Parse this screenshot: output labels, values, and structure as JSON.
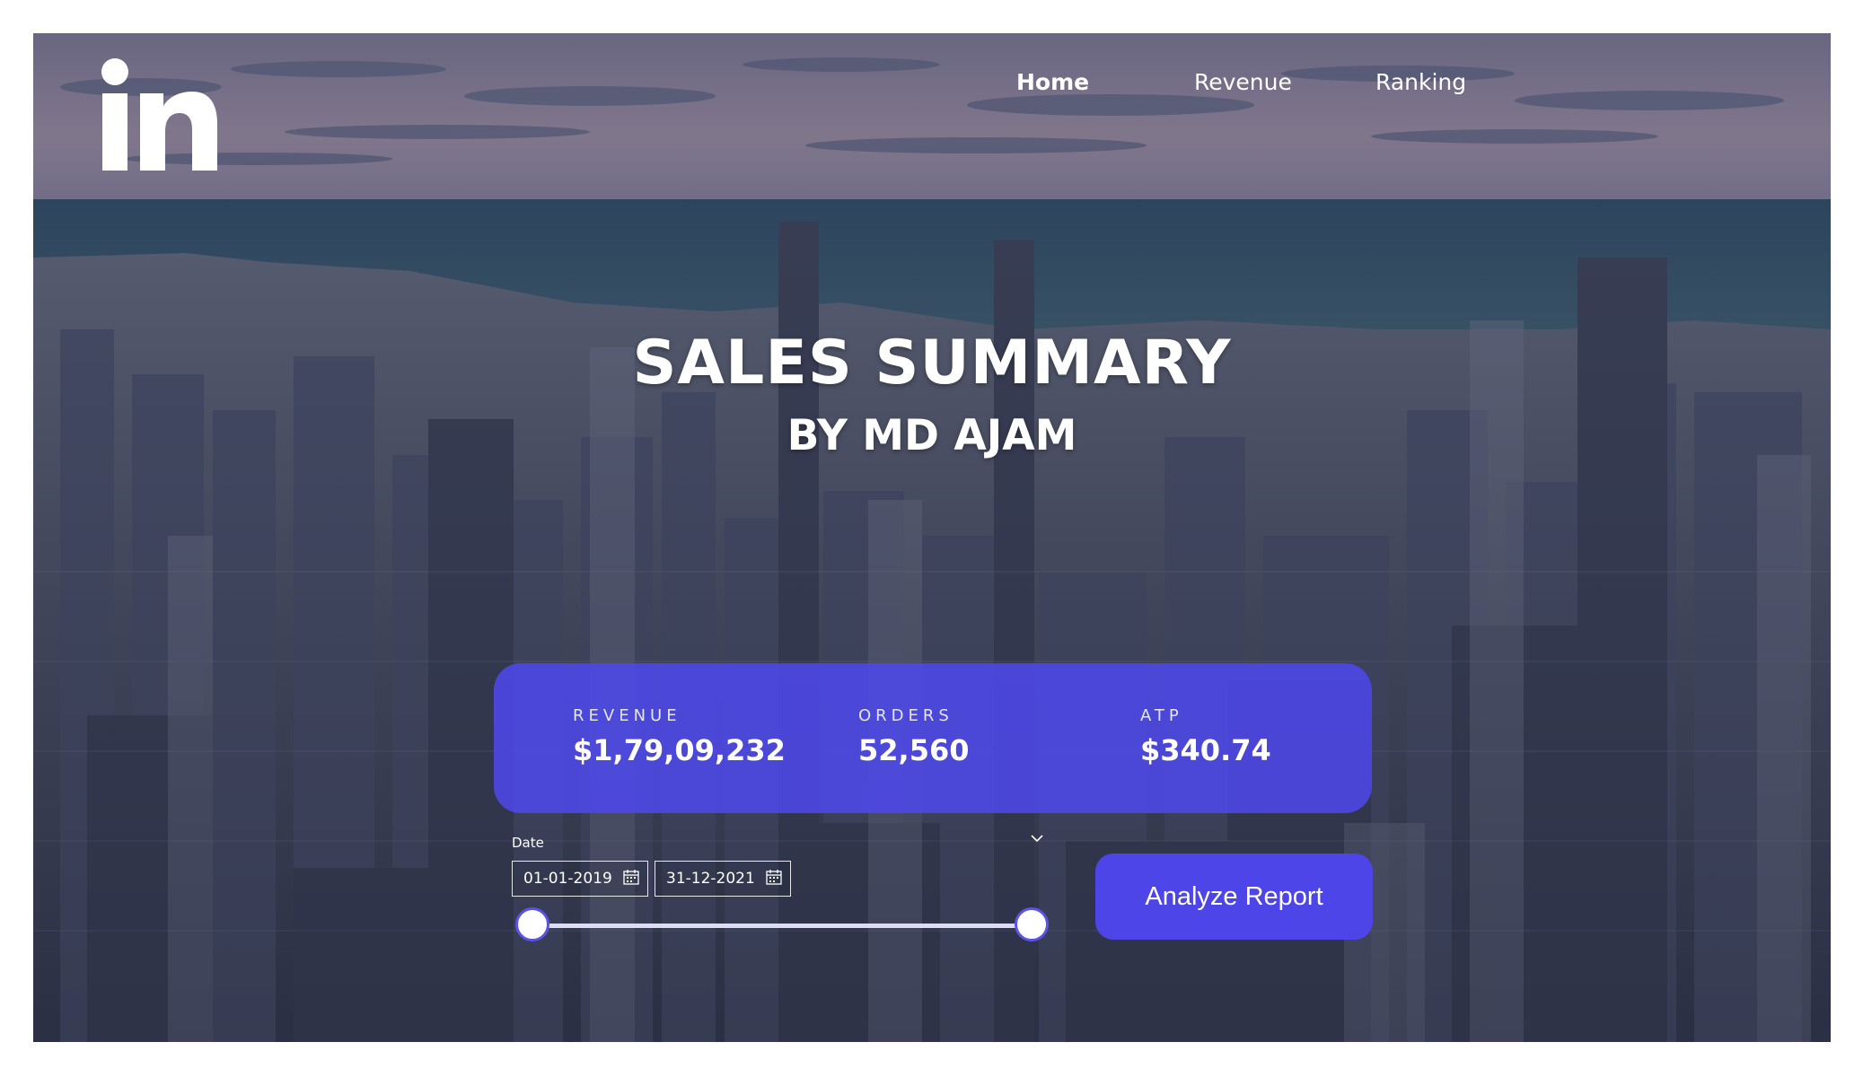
{
  "logo": {
    "icon": "linkedin-in-logo",
    "text": "in"
  },
  "nav": {
    "items": [
      {
        "label": "Home",
        "active": true
      },
      {
        "label": "Revenue",
        "active": false
      },
      {
        "label": "Ranking",
        "active": false
      }
    ]
  },
  "hero": {
    "title": "SALES SUMMARY",
    "subtitle": "BY MD AJAM"
  },
  "kpis": [
    {
      "label": "REVENUE",
      "value": "$1,79,09,232"
    },
    {
      "label": "ORDERS",
      "value": "52,560"
    },
    {
      "label": "ATP",
      "value": "$340.74"
    }
  ],
  "date_slicer": {
    "label": "Date",
    "start": "01-01-2019",
    "end": "31-12-2021",
    "range_fraction": [
      0,
      1
    ]
  },
  "action": {
    "label": "Analyze Report"
  },
  "colors": {
    "accent": "#4e45e9",
    "panel": "#4e48ec",
    "text": "#ffffff"
  }
}
